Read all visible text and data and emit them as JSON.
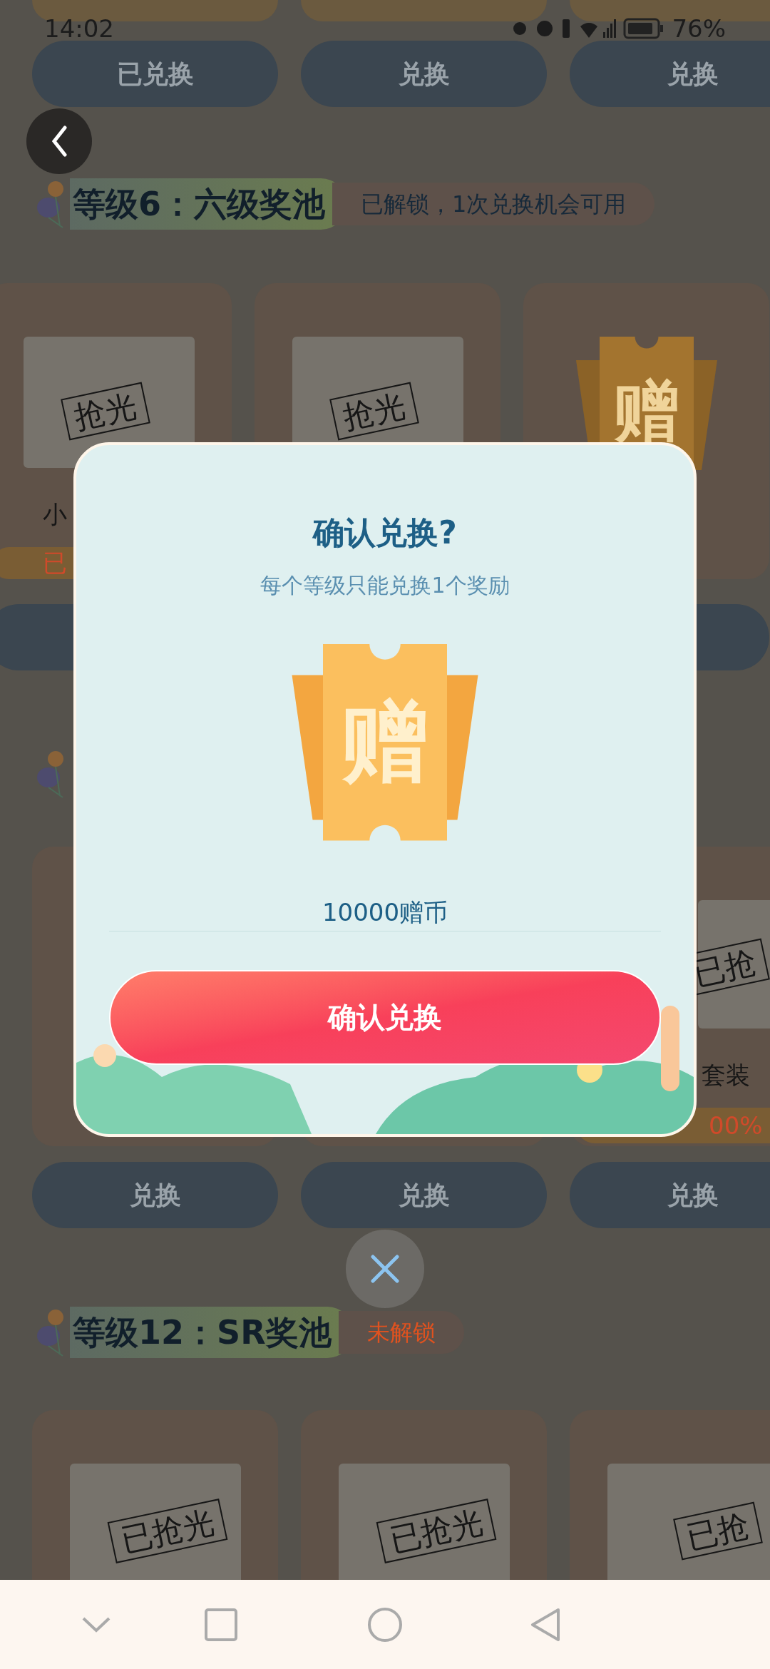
{
  "status_bar": {
    "time": "14:02",
    "battery": "76%"
  },
  "top_buttons": [
    {
      "label": "已兑换"
    },
    {
      "label": "兑换"
    },
    {
      "label": "兑换"
    }
  ],
  "level6": {
    "title": "等级6：六级奖池",
    "status": "已解锁，1次兑换机会可用",
    "locked": false
  },
  "level6_cards": [
    {
      "kind": "photo",
      "name": "小",
      "tag": "已",
      "stamp": "抢光"
    },
    {
      "kind": "photo",
      "stamp": "抢光"
    },
    {
      "kind": "ticket",
      "glyph": "赠"
    }
  ],
  "level_hidden_cards": [
    {
      "kind": "blank"
    },
    {
      "kind": "blank"
    },
    {
      "kind": "photo",
      "name": "套装",
      "progress": "00%",
      "stamp": "已抢"
    }
  ],
  "middle_buttons": [
    {
      "label": "兑换"
    },
    {
      "label": "兑换"
    },
    {
      "label": "兑换"
    }
  ],
  "level12": {
    "title": "等级12：SR奖池",
    "status": "未解锁",
    "locked": true
  },
  "level12_cards": [
    {
      "kind": "photo",
      "stamp": "已抢光"
    },
    {
      "kind": "photo",
      "stamp": "已抢光"
    },
    {
      "kind": "photo",
      "stamp": "已抢"
    }
  ],
  "dialog": {
    "title": "确认兑换?",
    "subtitle": "每个等级只能兑换1个奖励",
    "glyph": "赠",
    "price": "10000赠币",
    "confirm": "确认兑换"
  }
}
